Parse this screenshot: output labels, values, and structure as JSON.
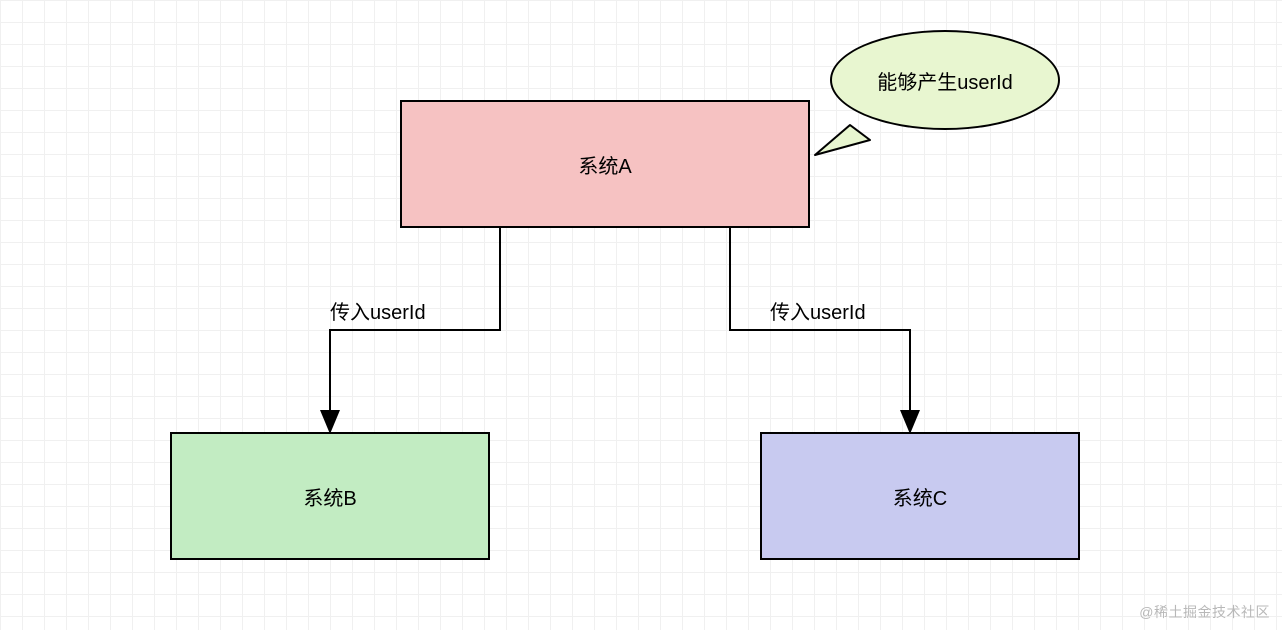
{
  "nodes": {
    "systemA": {
      "label": "系统A"
    },
    "systemB": {
      "label": "系统B"
    },
    "systemC": {
      "label": "系统C"
    }
  },
  "callout": {
    "text": "能够产生userId"
  },
  "edges": {
    "aToB": {
      "label": "传入userId"
    },
    "aToC": {
      "label": "传入userId"
    }
  },
  "watermark": "@稀土掘金技术社区"
}
